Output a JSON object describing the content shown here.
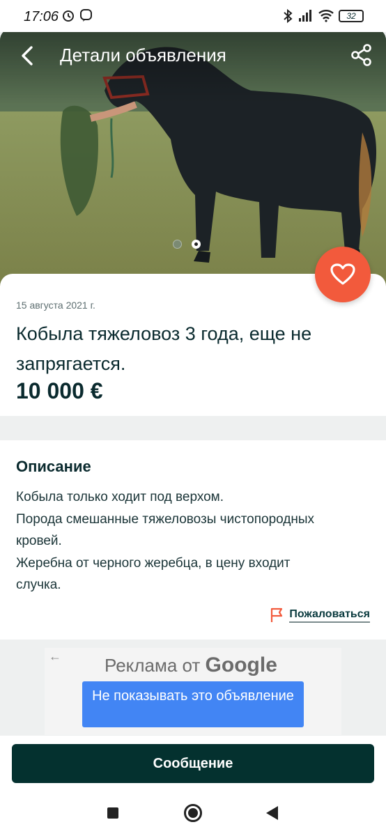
{
  "status_bar": {
    "time": "17:06",
    "battery": "32"
  },
  "header": {
    "title": "Детали объявления",
    "back_icon": "back-arrow-icon",
    "share_icon": "share-icon"
  },
  "gallery": {
    "image": "horse-photo",
    "pages": 2,
    "current_page": 2
  },
  "listing": {
    "date": "15 августа 2021 г.",
    "title": "Кобыла тяжеловоз 3 года, еще не запрягается.",
    "price": "10 000 €",
    "favorite_icon": "heart-icon",
    "favorite_color": "#f25a3c"
  },
  "description": {
    "heading": "Описание",
    "lines": [
      "Кобыла только ходит под верхом.",
      "Порода смешанные тяжеловозы чистопородных",
      "кровей.",
      "Жеребна от черного жеребца, в цену входит",
      "случка."
    ],
    "report_label": "Пожаловаться",
    "report_icon": "flag-icon",
    "report_icon_color": "#f25a3c"
  },
  "ad": {
    "title_prefix": "Реклама от",
    "title_brand": "Google",
    "button_label": "Не показывать это объявление",
    "button_color": "#4285f4"
  },
  "actions": {
    "message_label": "Сообщение",
    "message_color": "#04312f"
  }
}
